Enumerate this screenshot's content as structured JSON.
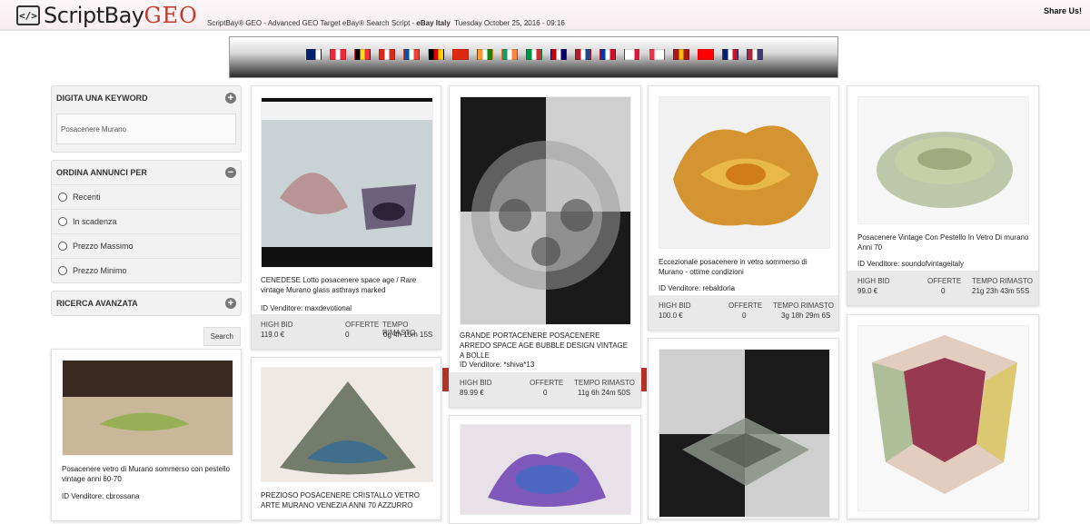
{
  "header": {
    "logo_icon": "</>",
    "logo_text": "ScriptBay",
    "logo_geo": "GEO",
    "tagline_prefix": "ScriptBay® GEO - Advanced GEO Target eBay® Search Script - ",
    "tagline_site": "eBay Italy",
    "tagline_date": "Tuesday October 25, 2016 - 09:16",
    "share_label": "Share Us!"
  },
  "flags": [
    {
      "name": "flag-australia",
      "colors": [
        "#012169",
        "#012169",
        "#ffffff"
      ]
    },
    {
      "name": "flag-austria",
      "colors": [
        "#ed2939",
        "#ffffff",
        "#ed2939"
      ]
    },
    {
      "name": "flag-belgium",
      "colors": [
        "#000000",
        "#fdda24",
        "#ef3340"
      ]
    },
    {
      "name": "flag-canada",
      "colors": [
        "#d52b1e",
        "#ffffff",
        "#d52b1e"
      ]
    },
    {
      "name": "flag-france",
      "colors": [
        "#0055a4",
        "#ffffff",
        "#ef4135"
      ]
    },
    {
      "name": "flag-germany",
      "colors": [
        "#000000",
        "#dd0000",
        "#ffce00"
      ]
    },
    {
      "name": "flag-hong-kong",
      "colors": [
        "#de2910",
        "#de2910",
        "#de2910"
      ]
    },
    {
      "name": "flag-india",
      "colors": [
        "#ff9933",
        "#ffffff",
        "#138808"
      ]
    },
    {
      "name": "flag-ireland",
      "colors": [
        "#169b62",
        "#ffffff",
        "#ff883e"
      ]
    },
    {
      "name": "flag-italy",
      "colors": [
        "#009246",
        "#ffffff",
        "#ce2b37"
      ]
    },
    {
      "name": "flag-malaysia",
      "colors": [
        "#cc0001",
        "#ffffff",
        "#010066"
      ]
    },
    {
      "name": "flag-netherlands",
      "colors": [
        "#ae1c28",
        "#ffffff",
        "#21468b"
      ]
    },
    {
      "name": "flag-philippines",
      "colors": [
        "#0038a8",
        "#ffffff",
        "#ce1126"
      ]
    },
    {
      "name": "flag-poland",
      "colors": [
        "#ffffff",
        "#ffffff",
        "#dc143c"
      ]
    },
    {
      "name": "flag-singapore",
      "colors": [
        "#ef3340",
        "#ffffff",
        "#ffffff"
      ]
    },
    {
      "name": "flag-spain",
      "colors": [
        "#aa151b",
        "#f1bf00",
        "#aa151b"
      ]
    },
    {
      "name": "flag-switzerland",
      "colors": [
        "#ff0000",
        "#ff0000",
        "#ff0000"
      ]
    },
    {
      "name": "flag-uk",
      "colors": [
        "#012169",
        "#ffffff",
        "#c8102e"
      ]
    },
    {
      "name": "flag-usa",
      "colors": [
        "#b22234",
        "#ffffff",
        "#3c3b6e"
      ]
    }
  ],
  "sidebar": {
    "keyword_title": "DIGITA UNA KEYWORD",
    "keyword_value": "Posacenere Murano",
    "sort_title": "ORDINA ANNUNCI PER",
    "sort_options": [
      "Recenti",
      "In scadenza",
      "Prezzo Massimo",
      "Prezzo Minimo"
    ],
    "advanced_title": "RICERCA AVANZATA",
    "search_label": "Search"
  },
  "stat_labels": {
    "bid": "HIGH BID",
    "offers": "OFFERTE",
    "time": "TEMPO RIMASTO"
  },
  "seller_prefix": "ID Venditore: ",
  "cards": [
    {
      "title": "CENEDESE Lotto posacenere space age / Rare vintage Murano glass asthrays marked",
      "seller": "maxdevotional",
      "bid": "119.0 €",
      "offers": "0",
      "time": "0g 4h 15m 15S"
    },
    {
      "title": "GRANDE PORTACENERE POSACENERE ARREDO SPACE AGE BUBBLE DESIGN VINTAGE A BOLLE",
      "seller": "*shiva*13",
      "bid": "89.99 €",
      "offers": "0",
      "time": "11g 6h 24m 50S"
    },
    {
      "title": "Eccezionale posacenere in vetro sommerso di Murano - ottime condizioni",
      "seller": "rebaldoria",
      "bid": "100.0 €",
      "offers": "0",
      "time": "3g 18h 29m 6S"
    },
    {
      "title": "Posacenere Vintage Con Pestello In Vetro Di murano Anni 70",
      "seller": "soundofvintageitaly",
      "bid": "99.0 €",
      "offers": "0",
      "time": "21g 23h 43m 55S"
    },
    {
      "title": "Posacenere vetro di Murano sommerso con pestello vintage anni 60-70",
      "seller": "cbrossana"
    },
    {
      "title": "PREZIOSO POSACENERE CRISTALLO VETRO ARTE MURANO VENEZIA ANNI 70 AZZURRO"
    },
    {
      "title": ""
    },
    {
      "title": ""
    },
    {
      "title": ""
    }
  ]
}
